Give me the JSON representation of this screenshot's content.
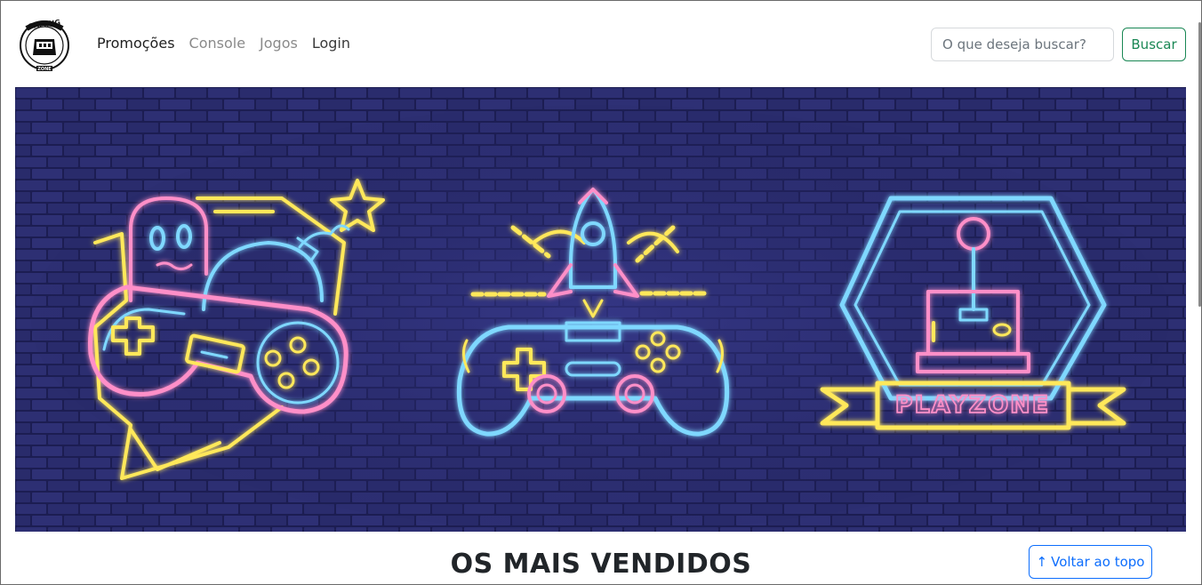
{
  "navbar": {
    "logo_alt": "GAMING ZONE",
    "links": [
      {
        "label": "Promoções"
      },
      {
        "label": "Console"
      },
      {
        "label": "Jogos"
      },
      {
        "label": "Login"
      }
    ],
    "search": {
      "placeholder": "O que deseja buscar?",
      "button_label": "Buscar"
    }
  },
  "banner": {
    "sign_text": "PLAYZONE",
    "colors": {
      "wall": "#1c1d52",
      "pink": "#ff8fc8",
      "blue": "#7fd8ff",
      "yellow": "#ffe85a"
    }
  },
  "main": {
    "section_title": "OS MAIS VENDIDOS",
    "back_to_top": {
      "arrow": "↑",
      "label": "Voltar ao topo"
    }
  },
  "colors": {
    "success": "#198754",
    "primary": "#0d6efd"
  }
}
